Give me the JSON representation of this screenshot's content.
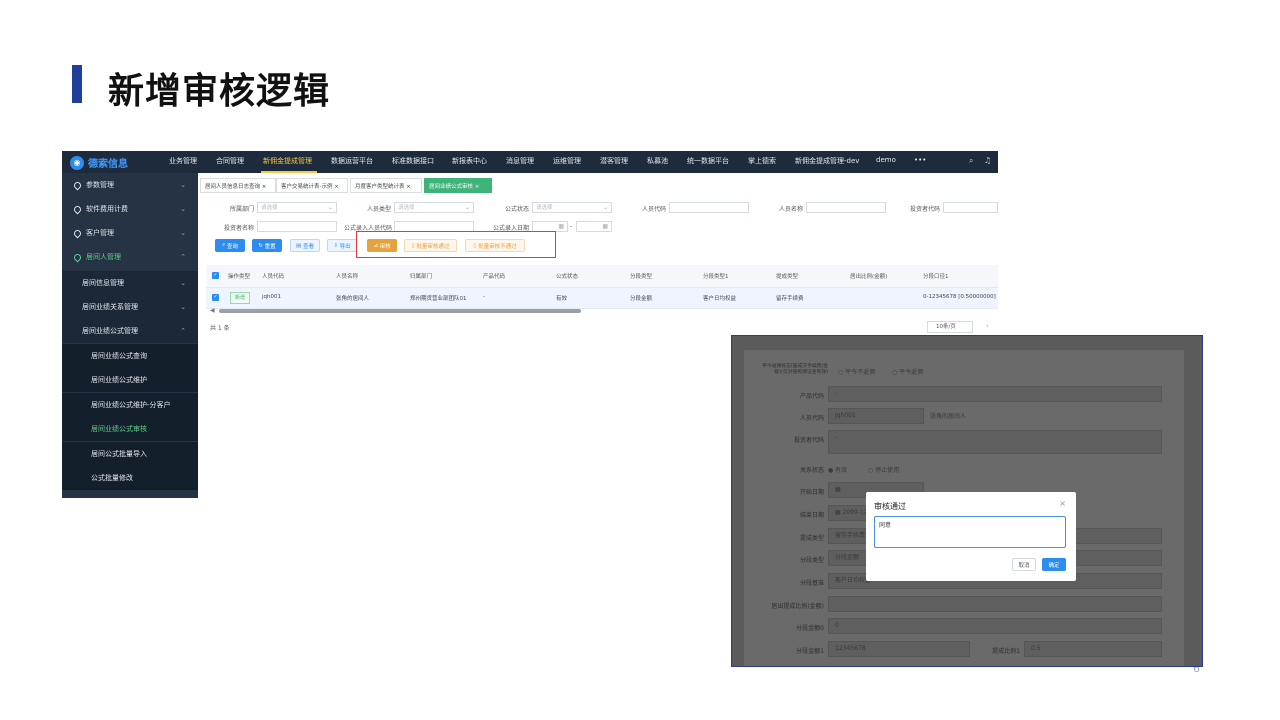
{
  "slide": {
    "title": "新增审核逻辑",
    "page_number": "6"
  },
  "app": {
    "logo": "德索信息",
    "nav": [
      "业务管理",
      "合同管理",
      "新佣金提成管理",
      "数据运营平台",
      "标准数据接口",
      "新报表中心",
      "消息管理",
      "运维管理",
      "潜客管理",
      "私募池",
      "统一数据平台",
      "掌上德索",
      "新佣金提成管理-dev",
      "demo",
      "•••"
    ],
    "sidebar": {
      "items": [
        "参数管理",
        "软件费用计费",
        "客户管理",
        "居间人管理"
      ],
      "sub": [
        "居间信息管理",
        "居间业绩关系管理",
        "居间业绩公式管理"
      ],
      "leaves": [
        "居间业绩公式查询",
        "居间业绩公式维护",
        "居间业绩公式维护-分客户",
        "居间业绩公式审核",
        "居间公式批量导入",
        "公式批量修改"
      ]
    },
    "tabs": [
      "居间人员信息日志查询 ×",
      "客户交易统计表-示例 ×",
      "月度客户类型统计表 ×",
      "居间业绩公式审核 ×"
    ],
    "filters": {
      "dept_label": "所属部门",
      "dept_ph": "请选择",
      "type_label": "人员类型",
      "type_ph": "请选择",
      "formula_status_label": "公式状态",
      "formula_status_ph": "请选择",
      "staff_code_label": "人员代码",
      "staff_name_label": "人员名称",
      "investor_code_label": "投资者代码",
      "investor_name_label": "投资者名称",
      "entry_staff_label": "公式录入人员代码",
      "entry_date_label": "公式录入日期",
      "date_sep": "-"
    },
    "buttons": {
      "query": "查询",
      "reset": "重置",
      "view": "查看",
      "export": "导出",
      "audit": "审核",
      "batch_pass": "批量审核通过",
      "batch_reject": "批量审核不通过"
    },
    "table": {
      "headers": [
        "操作类型",
        "人员代码",
        "人员名称",
        "归属部门",
        "产品代码",
        "公式状态",
        "分段类型",
        "分段类型1",
        "提成类型",
        "居出比例(金额)",
        "分段口径1"
      ],
      "row": [
        "新增",
        "jqh001",
        "张角的居间人",
        "郑州期货营业部团队01",
        "-",
        "有效",
        "分段金额",
        "客户日均权益",
        "留存手续费",
        "",
        "0-12345678 [0.50000000]"
      ]
    },
    "total": "共 1 条",
    "page_size": "10条/页"
  },
  "modal_shot": {
    "labels": [
      "平今返佣标志(居成交手续费/金额)(仅对按照保证金有效)",
      "产品代码",
      "人员代码",
      "投资者代码",
      "关系状态",
      "开始日期",
      "结束日期",
      "提成类型",
      "分段类型",
      "分段基准",
      "居出提成比例(金额)",
      "分段金额0",
      "分段金额1",
      "提成比例1"
    ],
    "radio1a": "平今不返佣",
    "radio1b": "平今返佣",
    "product": "-",
    "staff_code": "jqh001",
    "staff_name": "张角的居间人",
    "investor": "-",
    "status_a": "有效",
    "status_b": "停止使用",
    "end_date": "2099-12",
    "tier_type": "留存手续费",
    "seg_type": "分段金额",
    "seg_base": "客户日均权益",
    "amt0": "0",
    "amt1": "12345678",
    "ratio1": "0.5",
    "dialog": {
      "title": "审核通过",
      "close": "×",
      "text": "同意",
      "cancel": "取消",
      "ok": "确定"
    }
  }
}
